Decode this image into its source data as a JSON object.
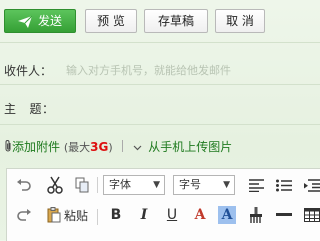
{
  "toolbar": {
    "send_label": "发送",
    "preview_label": "预 览",
    "draft_label": "存草稿",
    "cancel_label": "取 消"
  },
  "compose": {
    "recipient_label": "收件人：",
    "recipient_placeholder": "输入对方手机号，就能给他发邮件",
    "subject_label": "主   题："
  },
  "attachment": {
    "add_label": "添加附件",
    "limit_prefix": "(最大",
    "limit_value": "3G",
    "limit_suffix": ")",
    "phone_upload_label": "从手机上传图片"
  },
  "editor": {
    "font_select": "字体",
    "size_select": "字号",
    "paste_label": "粘贴",
    "bold": "B",
    "italic": "I",
    "underline": "U",
    "font_color": "A",
    "highlight": "A"
  },
  "colors": {
    "send_green": "#35a035",
    "link_green": "#1f7a1f",
    "limit_red": "#d11111",
    "font_color_red": "#c0392b",
    "highlight_blue": "#5a8fd6"
  },
  "icons": [
    "paper-plane-icon",
    "paperclip-icon",
    "chevron-down-icon",
    "undo-icon",
    "redo-icon",
    "scissors-icon",
    "copy-icon",
    "paste-icon",
    "align-left-icon",
    "bullet-list-icon",
    "indent-icon",
    "format-painter-icon",
    "horizontal-rule-icon",
    "table-icon"
  ]
}
